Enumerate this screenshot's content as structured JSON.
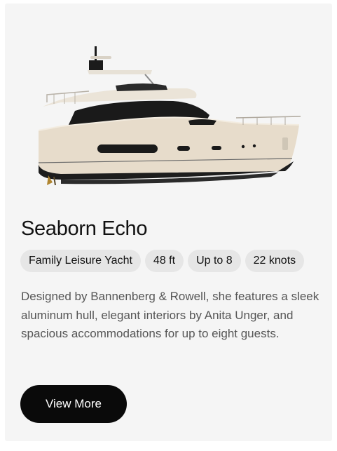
{
  "product": {
    "name": "Seaborn Echo",
    "image": "yacht-image",
    "specs": [
      {
        "key": "type",
        "label": "Family Leisure Yacht"
      },
      {
        "key": "length",
        "label": "48 ft"
      },
      {
        "key": "guests",
        "label": "Up to 8"
      },
      {
        "key": "speed",
        "label": "22 knots"
      }
    ],
    "description": "Designed by Bannenberg & Rowell, she features a sleek aluminum hull, elegant interiors by Anita Unger, and spacious accommodations for up to eight guests.",
    "cta_label": "View More"
  },
  "colors": {
    "card_bg": "#f5f5f5",
    "chip_bg": "#e6e6e6",
    "button_bg": "#0a0a0a",
    "hull_cream": "#e7dccb",
    "hull_dark": "#1d1d1d"
  }
}
